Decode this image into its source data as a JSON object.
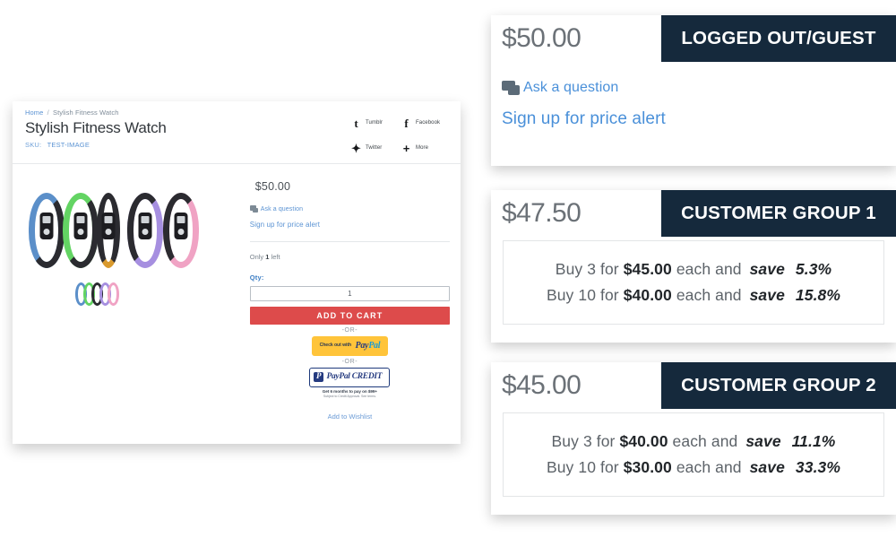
{
  "product_panel": {
    "breadcrumb": {
      "home": "Home",
      "separator": "/",
      "current": "Stylish Fitness Watch"
    },
    "title": "Stylish Fitness Watch",
    "sku_label": "SKU:",
    "sku_value": "TEST-IMAGE",
    "share": [
      {
        "icon": "tumblr-icon",
        "glyph": "t",
        "label": "Tumblr"
      },
      {
        "icon": "facebook-icon",
        "glyph": "f",
        "label": "Facebook"
      },
      {
        "icon": "twitter-icon",
        "glyph": "ᴠ",
        "label": "Twitter"
      },
      {
        "icon": "more-icon",
        "glyph": "+",
        "label": "More"
      }
    ],
    "gallery": {
      "bands": [
        "#5b8fc9",
        "#63d463",
        "#d99a2e",
        "#a68fe0",
        "#f0a3c4"
      ],
      "thumbs": [
        "#5b8fc9",
        "#63d463",
        "#d99a2e",
        "#a68fe0",
        "#f0a3c4"
      ]
    },
    "price": "$50.00",
    "ask_a_question": "Ask a question",
    "price_alert": "Sign up for price alert",
    "stock_prefix": "Only",
    "stock_count": "1",
    "stock_suffix": "left",
    "qty_label": "Qty:",
    "qty_value": "1",
    "add_to_cart": "ADD TO CART",
    "or_1": "-OR-",
    "or_2": "-OR-",
    "paypal": {
      "prefix": "Check out with",
      "pay": "Pay",
      "pal": "Pal"
    },
    "paypal_credit": {
      "brand_pay": "PayPal",
      "brand_credit": "CREDIT",
      "fine_1": "Get 6 months to pay on $99+",
      "fine_2": "Subject to Credit Approval. See terms."
    },
    "wishlist": "Add to Wishlist"
  },
  "cards": {
    "guest": {
      "price": "$50.00",
      "badge": "LOGGED OUT/GUEST",
      "ask_a_question": "Ask a question",
      "price_alert": "Sign up for price alert"
    },
    "group1": {
      "price": "$47.50",
      "badge": "CUSTOMER GROUP 1",
      "tiers": [
        {
          "buy_prefix": "Buy 3 for",
          "amount": "$45.00",
          "mid": "each and",
          "save": "save",
          "percent": "5.3%"
        },
        {
          "buy_prefix": "Buy 10 for",
          "amount": "$40.00",
          "mid": "each and",
          "save": "save",
          "percent": "15.8%"
        }
      ]
    },
    "group2": {
      "price": "$45.00",
      "badge": "CUSTOMER GROUP 2",
      "tiers": [
        {
          "buy_prefix": "Buy 3 for",
          "amount": "$40.00",
          "mid": "each and",
          "save": "save",
          "percent": "11.1%"
        },
        {
          "buy_prefix": "Buy 10 for",
          "amount": "$30.00",
          "mid": "each and",
          "save": "save",
          "percent": "33.3%"
        }
      ]
    }
  },
  "colors": {
    "badge_navy": "#15293c",
    "add_to_cart_red": "#dd4b4b",
    "link_blue": "#4a90d9",
    "paypal_yellow": "#ffc43a",
    "paypal_blue": "#253b80"
  }
}
